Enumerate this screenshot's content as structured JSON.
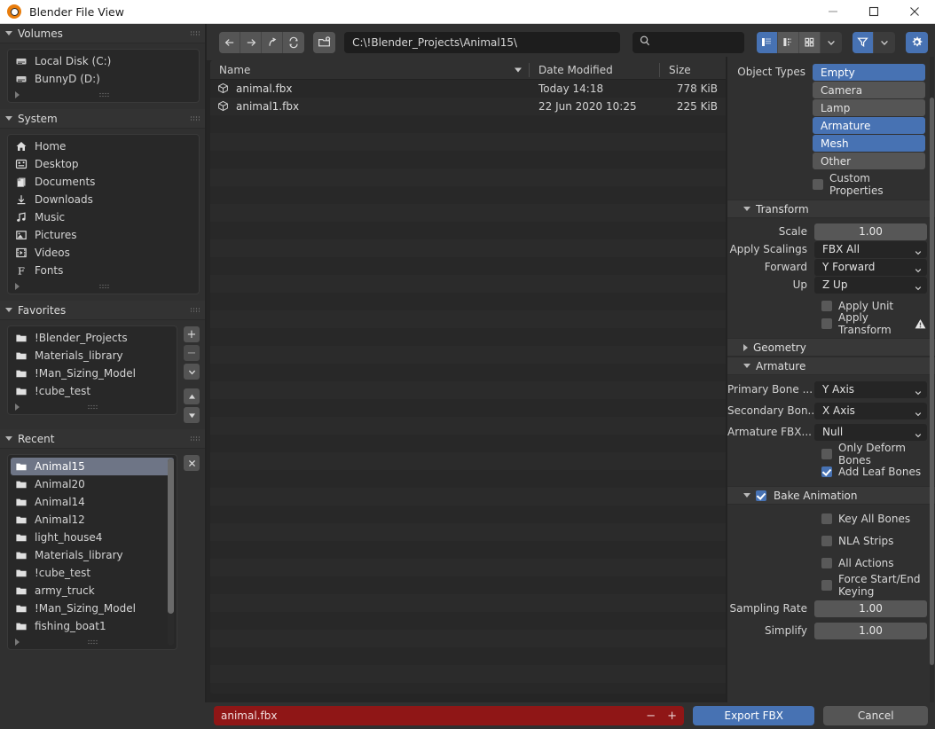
{
  "window": {
    "title": "Blender File View",
    "logo_icon": "blender-logo",
    "minimize_icon": "minimize-icon",
    "maximize_icon": "maximize-icon",
    "close_icon": "close-icon"
  },
  "sidebar": {
    "sections": [
      {
        "title": "Volumes",
        "items": [
          {
            "label": "Local Disk (C:)",
            "icon": "disk-icon"
          },
          {
            "label": "BunnyD (D:)",
            "icon": "disk-icon"
          }
        ]
      },
      {
        "title": "System",
        "items": [
          {
            "label": "Home",
            "icon": "home-icon"
          },
          {
            "label": "Desktop",
            "icon": "desktop-icon"
          },
          {
            "label": "Documents",
            "icon": "documents-icon"
          },
          {
            "label": "Downloads",
            "icon": "download-icon"
          },
          {
            "label": "Music",
            "icon": "music-icon"
          },
          {
            "label": "Pictures",
            "icon": "pictures-icon"
          },
          {
            "label": "Videos",
            "icon": "video-icon"
          },
          {
            "label": "Fonts",
            "icon": "font-icon"
          }
        ]
      },
      {
        "title": "Favorites",
        "items": [
          {
            "label": "!Blender_Projects",
            "icon": "folder-icon"
          },
          {
            "label": "Materials_library",
            "icon": "folder-icon"
          },
          {
            "label": "!Man_Sizing_Model",
            "icon": "folder-icon"
          },
          {
            "label": "!cube_test",
            "icon": "folder-icon"
          }
        ],
        "buttons": {
          "add": "+",
          "remove": "−",
          "down": "chevron-down-icon",
          "up_arrow": "up-arrow-icon",
          "down_arrow": "down-arrow-icon"
        }
      },
      {
        "title": "Recent",
        "items": [
          {
            "label": "Animal15",
            "icon": "folder-icon",
            "selected": true
          },
          {
            "label": "Animal20",
            "icon": "folder-icon"
          },
          {
            "label": "Animal14",
            "icon": "folder-icon"
          },
          {
            "label": "Animal12",
            "icon": "folder-icon"
          },
          {
            "label": "light_house4",
            "icon": "folder-icon"
          },
          {
            "label": "Materials_library",
            "icon": "folder-icon"
          },
          {
            "label": "!cube_test",
            "icon": "folder-icon"
          },
          {
            "label": "army_truck",
            "icon": "folder-icon"
          },
          {
            "label": "!Man_Sizing_Model",
            "icon": "folder-icon"
          },
          {
            "label": "fishing_boat1",
            "icon": "folder-icon"
          }
        ],
        "clear_button": "close-icon"
      }
    ]
  },
  "toolbar": {
    "back_icon": "arrow-left-icon",
    "forward_icon": "arrow-right-icon",
    "up_icon": "arrow-up-parent-icon",
    "refresh_icon": "refresh-icon",
    "new_folder_icon": "new-folder-icon",
    "path_value": "C:\\!Blender_Projects\\Animal15\\",
    "search_placeholder": "",
    "search_icon": "search-icon",
    "view_list_icon": "view-vertical-list-icon",
    "view_detail_icon": "view-detail-list-icon",
    "view_thumb_icon": "view-thumbnail-icon",
    "view_chevron_icon": "chevron-down-icon",
    "filter_icon": "filter-funnel-icon",
    "filter_chevron_icon": "chevron-down-icon",
    "settings_icon": "gear-icon"
  },
  "filelist": {
    "columns": [
      "Name",
      "Date Modified",
      "Size"
    ],
    "sort_indicator": "sort-descending-icon",
    "rows": [
      {
        "name": "animal.fbx",
        "date": "Today 14:18",
        "size": "778 KiB",
        "icon": "mesh-cube-icon"
      },
      {
        "name": "animal1.fbx",
        "date": "22 Jun 2020 10:25",
        "size": "225 KiB",
        "icon": "mesh-cube-icon"
      }
    ]
  },
  "properties": {
    "object_types": {
      "label": "Object Types",
      "options": [
        {
          "label": "Empty",
          "selected": true
        },
        {
          "label": "Camera",
          "selected": false
        },
        {
          "label": "Lamp",
          "selected": false
        },
        {
          "label": "Armature",
          "selected": true
        },
        {
          "label": "Mesh",
          "selected": true
        },
        {
          "label": "Other",
          "selected": false
        }
      ],
      "custom_properties": {
        "label": "Custom Properties",
        "checked": false
      }
    },
    "transform": {
      "title": "Transform",
      "expanded": true,
      "scale": {
        "label": "Scale",
        "value": "1.00"
      },
      "apply_scalings": {
        "label": "Apply Scalings",
        "value": "FBX All"
      },
      "forward": {
        "label": "Forward",
        "value": "Y Forward"
      },
      "up": {
        "label": "Up",
        "value": "Z Up"
      },
      "apply_unit": {
        "label": "Apply Unit",
        "checked": false
      },
      "apply_transform": {
        "label": "Apply Transform",
        "checked": false,
        "warning_icon": "warning-triangle-icon"
      }
    },
    "geometry": {
      "title": "Geometry",
      "expanded": false
    },
    "armature": {
      "title": "Armature",
      "expanded": true,
      "primary_bone": {
        "label": "Primary Bone ...",
        "value": "Y Axis"
      },
      "secondary_bone": {
        "label": "Secondary Bon...",
        "value": "X Axis"
      },
      "armature_fbx": {
        "label": "Armature FBX...",
        "value": "Null"
      },
      "only_deform_bones": {
        "label": "Only Deform Bones",
        "checked": false
      },
      "add_leaf_bones": {
        "label": "Add Leaf Bones",
        "checked": true
      }
    },
    "bake_animation": {
      "title": "Bake Animation",
      "expanded": true,
      "checked": true,
      "key_all_bones": {
        "label": "Key All Bones",
        "checked": false
      },
      "nla_strips": {
        "label": "NLA Strips",
        "checked": false
      },
      "all_actions": {
        "label": "All Actions",
        "checked": false
      },
      "force_start_end_keying": {
        "label": "Force Start/End Keying",
        "checked": false
      },
      "sampling_rate": {
        "label": "Sampling Rate",
        "value": "1.00"
      },
      "simplify": {
        "label": "Simplify",
        "value": "1.00"
      }
    }
  },
  "bottombar": {
    "filename": "animal.fbx",
    "decrement": "−",
    "increment": "+",
    "export_label": "Export FBX",
    "cancel_label": "Cancel"
  },
  "colors": {
    "accent_blue": "#4772b3",
    "error_red": "#8f1616",
    "selection_grey": "#6e7586",
    "panel_bg": "#303030",
    "list_bg": "#282828"
  }
}
